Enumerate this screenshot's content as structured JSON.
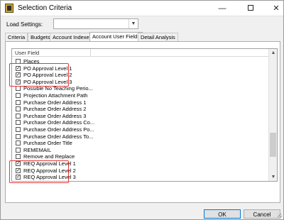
{
  "window": {
    "title": "Selection Criteria",
    "controls": {
      "minimize": "—",
      "close": "✕"
    }
  },
  "load_settings": {
    "label": "Load Settings:",
    "value": ""
  },
  "tabs": [
    {
      "label": "Criteria",
      "active": false
    },
    {
      "label": "Budgets",
      "active": false
    },
    {
      "label": "Account Indexes",
      "active": false
    },
    {
      "label": "Account User Fields",
      "active": true
    },
    {
      "label": "Detail Analysis",
      "active": false
    }
  ],
  "list": {
    "column_header": "User Field",
    "items": [
      {
        "label": "Places",
        "checked": false
      },
      {
        "label": "PO Approval Level 1",
        "checked": true
      },
      {
        "label": "PO Approval Level 2",
        "checked": true
      },
      {
        "label": "PO Approval Level 3",
        "checked": true
      },
      {
        "label": "Possible No Teaching Perio...",
        "checked": false
      },
      {
        "label": "Projection Attachment Path",
        "checked": false
      },
      {
        "label": "Purchase Order Address 1",
        "checked": false
      },
      {
        "label": "Purchase Order Address 2",
        "checked": false
      },
      {
        "label": "Purchase Order Address 3",
        "checked": false
      },
      {
        "label": "Purchase Order Address Co...",
        "checked": false
      },
      {
        "label": "Purchase Order Address Po...",
        "checked": false
      },
      {
        "label": "Purchase Order Address To...",
        "checked": false
      },
      {
        "label": "Purchase Order Title",
        "checked": false
      },
      {
        "label": "REMEMAIL",
        "checked": false
      },
      {
        "label": "Remove and Replace",
        "checked": false
      },
      {
        "label": "REQ Approval Level 1",
        "checked": true
      },
      {
        "label": "REQ Approval Level 2",
        "checked": true
      },
      {
        "label": "REQ Approval Level 3",
        "checked": true
      }
    ]
  },
  "buttons": {
    "ok": "OK",
    "cancel": "Cancel"
  },
  "colors": {
    "highlight": "#e23a3a",
    "accent": "#0078d7"
  }
}
